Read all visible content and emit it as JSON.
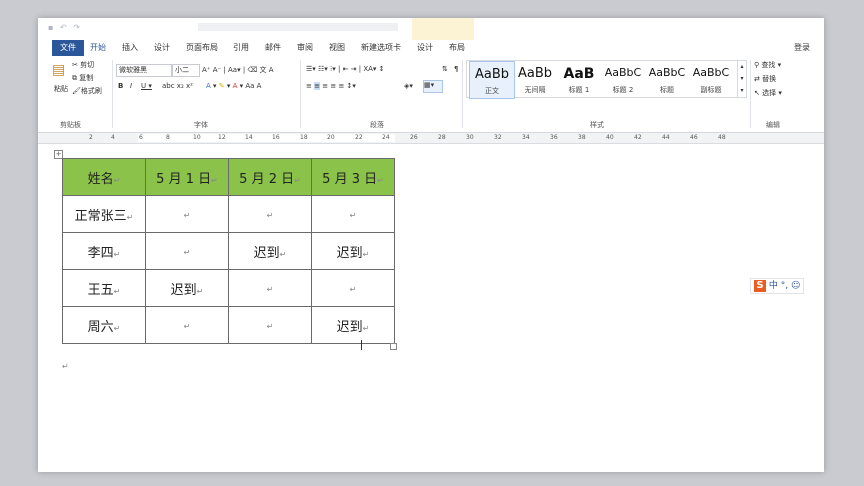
{
  "tabs": {
    "file": "文件",
    "home": "开始",
    "insert": "插入",
    "design": "设计",
    "layout": "页面布局",
    "references": "引用",
    "mailings": "邮件",
    "review": "审阅",
    "view": "视图",
    "new_tab": "新建选项卡",
    "table_design": "设计",
    "table_layout": "布局",
    "login": "登录"
  },
  "ribbon": {
    "cut": "剪切",
    "copy": "复制",
    "paste": "粘贴",
    "format_painter": "格式刷",
    "font_name": "微软雅黑",
    "font_size": "小二",
    "find": "查找",
    "replace": "替换",
    "select": "选择",
    "groups": {
      "clipboard": "剪贴板",
      "font": "字体",
      "paragraph": "段落",
      "styles": "样式",
      "editing": "编辑"
    },
    "styles": [
      {
        "sample": "AaBb",
        "name": "正文"
      },
      {
        "sample": "AaBb",
        "name": "无间隔"
      },
      {
        "sample": "AaB",
        "name": "标题 1"
      },
      {
        "sample": "AaBbC",
        "name": "标题 2"
      },
      {
        "sample": "AaBbC",
        "name": "标题"
      },
      {
        "sample": "AaBbC",
        "name": "副标题"
      }
    ]
  },
  "ruler": [
    "2",
    "4",
    "6",
    "8",
    "10",
    "12",
    "14",
    "16",
    "18",
    "20",
    "22",
    "24",
    "26",
    "28",
    "30",
    "32",
    "34",
    "36",
    "38",
    "40",
    "42",
    "44",
    "46",
    "48"
  ],
  "table": {
    "headers": [
      "姓名",
      "5 月 1 日",
      "5 月 2 日",
      "5 月 3 日"
    ],
    "rows": [
      [
        "正常张三",
        "",
        "",
        ""
      ],
      [
        "李四",
        "",
        "迟到",
        "迟到"
      ],
      [
        "王五",
        "迟到",
        "",
        ""
      ],
      [
        "周六",
        "",
        "",
        "迟到"
      ]
    ],
    "header_color": "#8bc34a"
  },
  "ime": {
    "logo": "S",
    "mode": "中"
  }
}
